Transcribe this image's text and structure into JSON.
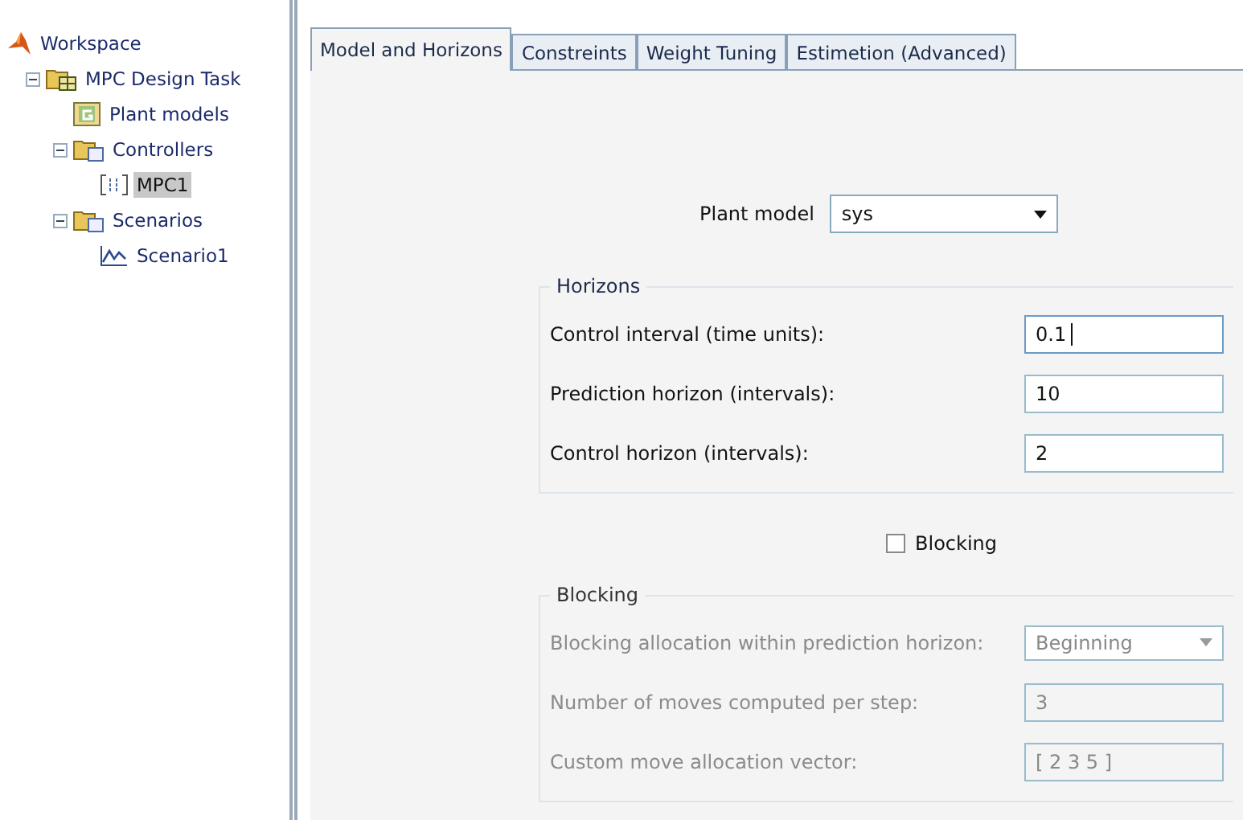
{
  "tree": {
    "label": "Workspace",
    "kind": "workspace",
    "children": [
      {
        "label": "MPC Design Task",
        "kind": "task",
        "expanded": true,
        "selected": false,
        "children": [
          {
            "label": "Plant models",
            "kind": "plant",
            "selected": false
          },
          {
            "label": "Controllers",
            "kind": "folder",
            "expanded": true,
            "selected": false,
            "children": [
              {
                "label": "MPC1",
                "kind": "controller",
                "selected": true
              }
            ]
          },
          {
            "label": "Scenarios",
            "kind": "folder",
            "expanded": true,
            "selected": false,
            "children": [
              {
                "label": "Scenario1",
                "kind": "scenario",
                "selected": false
              }
            ]
          }
        ]
      }
    ]
  },
  "tabs": [
    {
      "label": "Model and Horizons",
      "selected": true
    },
    {
      "label": "Constreints",
      "selected": false
    },
    {
      "label": "Weight Tuning",
      "selected": false
    },
    {
      "label": "Estimetion (Advanced)",
      "selected": false
    }
  ],
  "plant_model": {
    "label": "Plant model",
    "value": "sys"
  },
  "horizons": {
    "title": "Horizons",
    "disabled": false,
    "fields": [
      {
        "kind": "text",
        "label": "Control interval (time units):",
        "value": "0.1",
        "focused": true
      },
      {
        "kind": "text",
        "label": "Prediction horizon (intervals):",
        "value": "10",
        "focused": false
      },
      {
        "kind": "text",
        "label": "Control horizon (intervals):",
        "value": "2",
        "focused": false
      }
    ]
  },
  "blocking_checkbox": {
    "label": "Blocking",
    "checked": false
  },
  "blocking": {
    "title": "Blocking",
    "disabled": true,
    "fields": [
      {
        "kind": "dropdown",
        "label": "Blocking allocation within prediction horizon:",
        "value": "Beginning"
      },
      {
        "kind": "text",
        "label": "Number of moves computed per step:",
        "value": "3",
        "focused": false
      },
      {
        "kind": "text",
        "label": "Custom move allocation vector:",
        "value": "[ 2 3 5 ]",
        "focused": false
      }
    ]
  }
}
